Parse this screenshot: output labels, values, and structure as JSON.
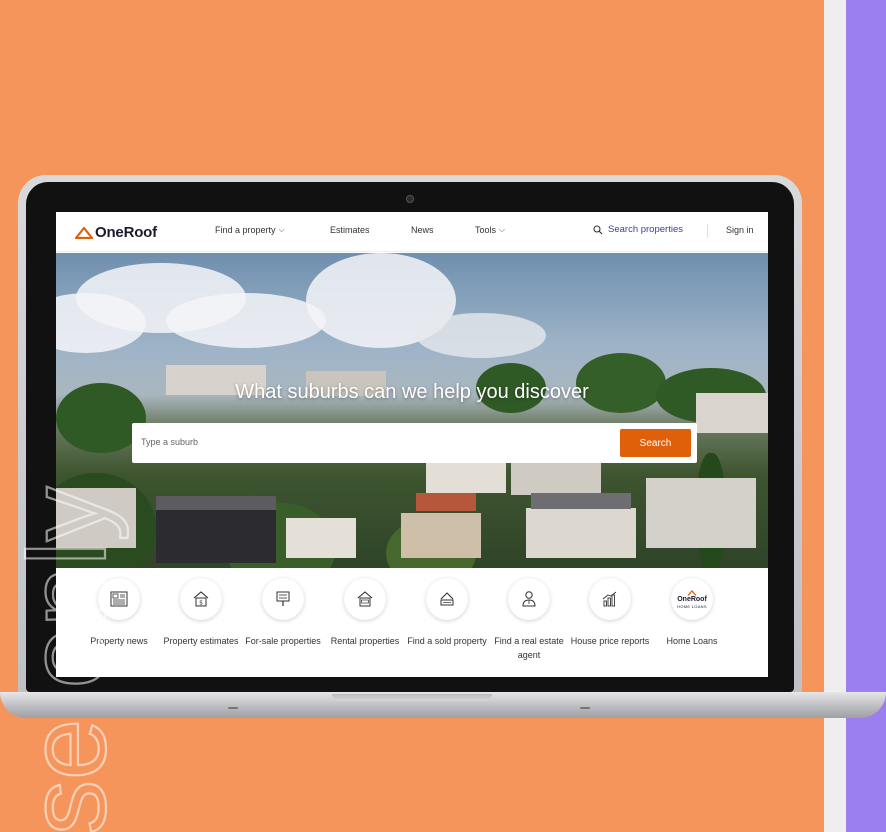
{
  "colors": {
    "background_orange": "#F5955B",
    "background_purple": "#9B7FF0",
    "accent": "#E0600A",
    "link": "#3a3fa8"
  },
  "nav": {
    "logo": "OneRoof",
    "items": [
      {
        "label": "Find a property",
        "has_dropdown": true
      },
      {
        "label": "Estimates",
        "has_dropdown": false
      },
      {
        "label": "News",
        "has_dropdown": false
      },
      {
        "label": "Tools",
        "has_dropdown": true
      }
    ],
    "search_label": "Search properties",
    "sign_in": "Sign in"
  },
  "hero": {
    "title": "What suburbs can we help you discover",
    "search_placeholder": "Type a suburb",
    "search_button": "Search"
  },
  "quick_links": [
    {
      "label": "Property news",
      "icon": "newspaper-icon"
    },
    {
      "label": "Property estimates",
      "icon": "house-dollar-icon"
    },
    {
      "label": "For-sale properties",
      "icon": "for-sale-sign-icon"
    },
    {
      "label": "Rental properties",
      "icon": "rent-house-icon"
    },
    {
      "label": "Find a sold property",
      "icon": "sold-sign-icon"
    },
    {
      "label": "Find a real estate agent",
      "icon": "agent-icon"
    },
    {
      "label": "House price reports",
      "icon": "chart-icon"
    },
    {
      "label": "Home Loans",
      "icon": "oneroof-home-loans-logo",
      "logo_text": "OneRoof",
      "logo_sub": "HOME LOANS"
    }
  ],
  "watermark": "se only"
}
